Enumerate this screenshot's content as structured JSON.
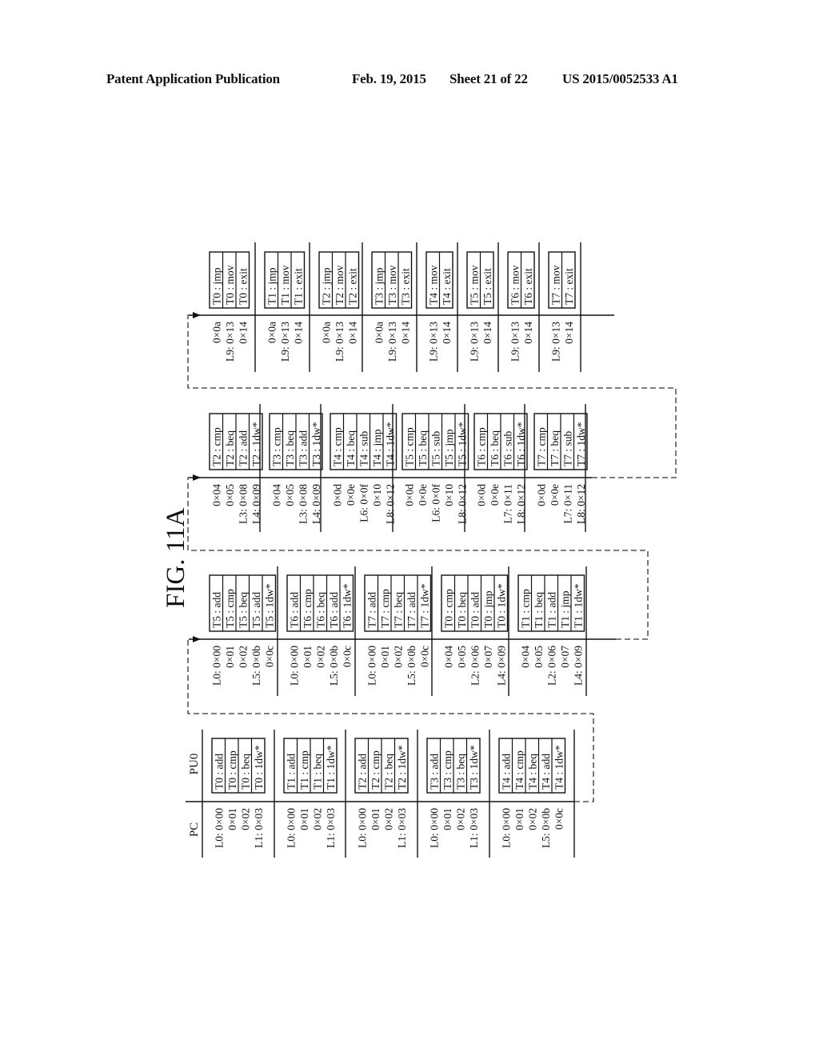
{
  "header": {
    "publication": "Patent Application Publication",
    "date": "Feb. 19, 2015",
    "sheet": "Sheet 21 of 22",
    "number": "US 2015/0052533 A1"
  },
  "figure": {
    "label": "FIG. 11A",
    "pc_header": "PC",
    "pu_header": "PU0",
    "stages": [
      {
        "groups": [
          {
            "pc": [
              "L0: 0×00",
              "0×01",
              "0×02",
              "L1: 0×03"
            ],
            "instr": [
              "T0 : add",
              "T0 : cmp",
              "T0 : beq",
              "T0 : 1dw*"
            ]
          },
          {
            "pc": [
              "L0: 0×00",
              "0×01",
              "0×02",
              "L1: 0×03"
            ],
            "instr": [
              "T1 : add",
              "T1 : cmp",
              "T1 : beq",
              "T1 : 1dw*"
            ]
          },
          {
            "pc": [
              "L0: 0×00",
              "0×01",
              "0×02",
              "L1: 0×03"
            ],
            "instr": [
              "T2 : add",
              "T2 : cmp",
              "T2 : beq",
              "T2 : 1dw*"
            ]
          },
          {
            "pc": [
              "L0: 0×00",
              "0×01",
              "0×02",
              "L1: 0×03"
            ],
            "instr": [
              "T3 : add",
              "T3 : cmp",
              "T3 : beq",
              "T3 : 1dw*"
            ]
          },
          {
            "pc": [
              "L0: 0×00",
              "0×01",
              "0×02",
              "L5: 0×0b",
              "0×0c"
            ],
            "instr": [
              "T4 : add",
              "T4 : cmp",
              "T4 : beq",
              "T4 : add",
              "T4 : 1dw*"
            ]
          }
        ]
      },
      {
        "groups": [
          {
            "pc": [
              "L0: 0×00",
              "0×01",
              "0×02",
              "L5: 0×0b",
              "0×0c"
            ],
            "instr": [
              "T5 : add",
              "T5 : cmp",
              "T5 : beq",
              "T5 : add",
              "T5 : 1dw*"
            ]
          },
          {
            "pc": [
              "L0: 0×00",
              "0×01",
              "0×02",
              "L5: 0×0b",
              "0×0c"
            ],
            "instr": [
              "T6 : add",
              "T6 : cmp",
              "T6 : beq",
              "T6 : add",
              "T6 : 1dw*"
            ]
          },
          {
            "pc": [
              "L0: 0×00",
              "0×01",
              "0×02",
              "L5: 0×0b",
              "0×0c"
            ],
            "instr": [
              "T7 : add",
              "T7 : cmp",
              "T7 : beq",
              "T7 : add",
              "T7 : 1dw*"
            ]
          },
          {
            "pc": [
              "0×04",
              "0×05",
              "L2: 0×06",
              "0×07",
              "L4: 0×09"
            ],
            "instr": [
              "T0 : cmp",
              "T0 : beq",
              "T0 : add",
              "T0 : jmp",
              "T0 : 1dw*"
            ]
          },
          {
            "pc": [
              "0×04",
              "0×05",
              "L2: 0×06",
              "0×07",
              "L4: 0×09"
            ],
            "instr": [
              "T1 : cmp",
              "T1 : beq",
              "T1 : add",
              "T1 : jmp",
              "T1 : 1dw*"
            ]
          }
        ]
      },
      {
        "groups": [
          {
            "pc": [
              "0×04",
              "0×05",
              "L3: 0×08",
              "L4: 0×09"
            ],
            "instr": [
              "T2 : cmp",
              "T2 : beq",
              "T2 : add",
              "T2 : 1dw*"
            ]
          },
          {
            "pc": [
              "0×04",
              "0×05",
              "L3: 0×08",
              "L4: 0×09"
            ],
            "instr": [
              "T3 : cmp",
              "T3 : beq",
              "T3 : add",
              "T3 : 1dw*"
            ]
          },
          {
            "pc": [
              "0×0d",
              "0×0e",
              "L6: 0×0f",
              "0×10",
              "L8: 0×12"
            ],
            "instr": [
              "T4 : cmp",
              "T4 : beq",
              "T4 : sub",
              "T4 : jmp",
              "T4 : 1dw*"
            ]
          },
          {
            "pc": [
              "0×0d",
              "0×0e",
              "L6: 0×0f",
              "0×10",
              "L8: 0×12"
            ],
            "instr": [
              "T5 : cmp",
              "T5 : beq",
              "T5 : sub",
              "T5 : jmp",
              "T5 : 1dw*"
            ]
          },
          {
            "pc": [
              "0×0d",
              "0×0e",
              "L7: 0×11",
              "L8: 0×12"
            ],
            "instr": [
              "T6 : cmp",
              "T6 : beq",
              "T6 : sub",
              "T6 : 1dw*"
            ]
          },
          {
            "pc": [
              "0×0d",
              "0×0e",
              "L7: 0×11",
              "L8: 0×12"
            ],
            "instr": [
              "T7 : cmp",
              "T7 : beq",
              "T7 : sub",
              "T7 : 1dw*"
            ]
          }
        ]
      },
      {
        "groups": [
          {
            "pc": [
              "0×0a",
              "L9: 0×13",
              "0×14"
            ],
            "instr": [
              "T0 : jmp",
              "T0 : mov",
              "T0 : exit"
            ]
          },
          {
            "pc": [
              "0×0a",
              "L9: 0×13",
              "0×14"
            ],
            "instr": [
              "T1 : jmp",
              "T1 : mov",
              "T1 : exit"
            ]
          },
          {
            "pc": [
              "0×0a",
              "L9: 0×13",
              "0×14"
            ],
            "instr": [
              "T2 : jmp",
              "T2 : mov",
              "T2 : exit"
            ]
          },
          {
            "pc": [
              "0×0a",
              "L9: 0×13",
              "0×14"
            ],
            "instr": [
              "T3 : jmp",
              "T3 : mov",
              "T3 : exit"
            ]
          },
          {
            "pc": [
              "L9: 0×13",
              "0×14"
            ],
            "instr": [
              "T4 : mov",
              "T4 : exit"
            ]
          },
          {
            "pc": [
              "L9: 0×13",
              "0×14"
            ],
            "instr": [
              "T5 : mov",
              "T5 : exit"
            ]
          },
          {
            "pc": [
              "L9: 0×13",
              "0×14"
            ],
            "instr": [
              "T6 : mov",
              "T6 : exit"
            ]
          },
          {
            "pc": [
              "L9: 0×13",
              "0×14"
            ],
            "instr": [
              "T7 : mov",
              "T7 : exit"
            ]
          }
        ]
      }
    ]
  }
}
